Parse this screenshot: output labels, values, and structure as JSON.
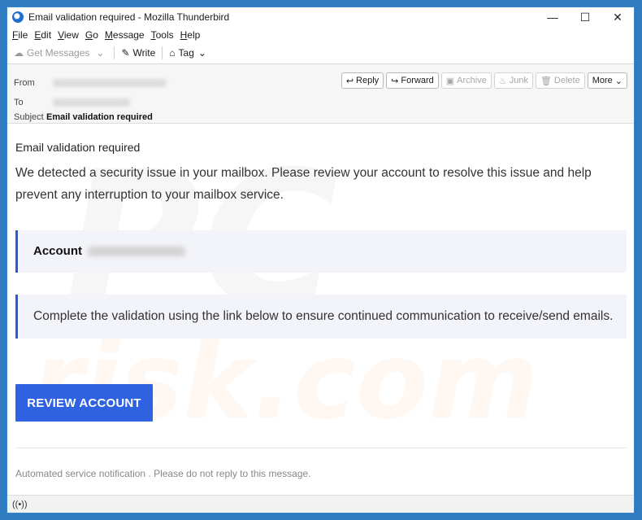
{
  "window": {
    "title": "Email validation required - Mozilla Thunderbird",
    "minimize": "—",
    "maximize": "☐",
    "close": "✕"
  },
  "menu": {
    "file": {
      "u": "F",
      "rest": "ile"
    },
    "edit": {
      "u": "E",
      "rest": "dit"
    },
    "view": {
      "u": "V",
      "rest": "iew"
    },
    "go": {
      "u": "G",
      "rest": "o"
    },
    "message": {
      "u": "M",
      "rest": "essage"
    },
    "tools": {
      "u": "T",
      "rest": "ools"
    },
    "help": {
      "u": "H",
      "rest": "elp"
    }
  },
  "toolbar": {
    "get_messages": "Get Messages",
    "write": "Write",
    "tag": "Tag"
  },
  "header": {
    "from_label": "From",
    "to_label": "To",
    "subject_label": "Subject",
    "subject_value": "Email validation required"
  },
  "actions": {
    "reply": "Reply",
    "forward": "Forward",
    "archive": "Archive",
    "junk": "Junk",
    "delete": "Delete",
    "more": "More"
  },
  "email": {
    "title": "Email validation required",
    "paragraph": "We detected a security issue in your mailbox. Please review your account to resolve this issue and help prevent any interruption to your mailbox service.",
    "account_label": "Account",
    "notice": "Complete the validation using the link below to ensure continued communication to receive/send emails.",
    "cta": "REVIEW ACCOUNT",
    "footer": "Automated service notification . Please do not reply to this message."
  },
  "colors": {
    "accent": "#2f62e0",
    "box_border": "#2a5bd7",
    "box_bg": "#f3f4f9"
  }
}
